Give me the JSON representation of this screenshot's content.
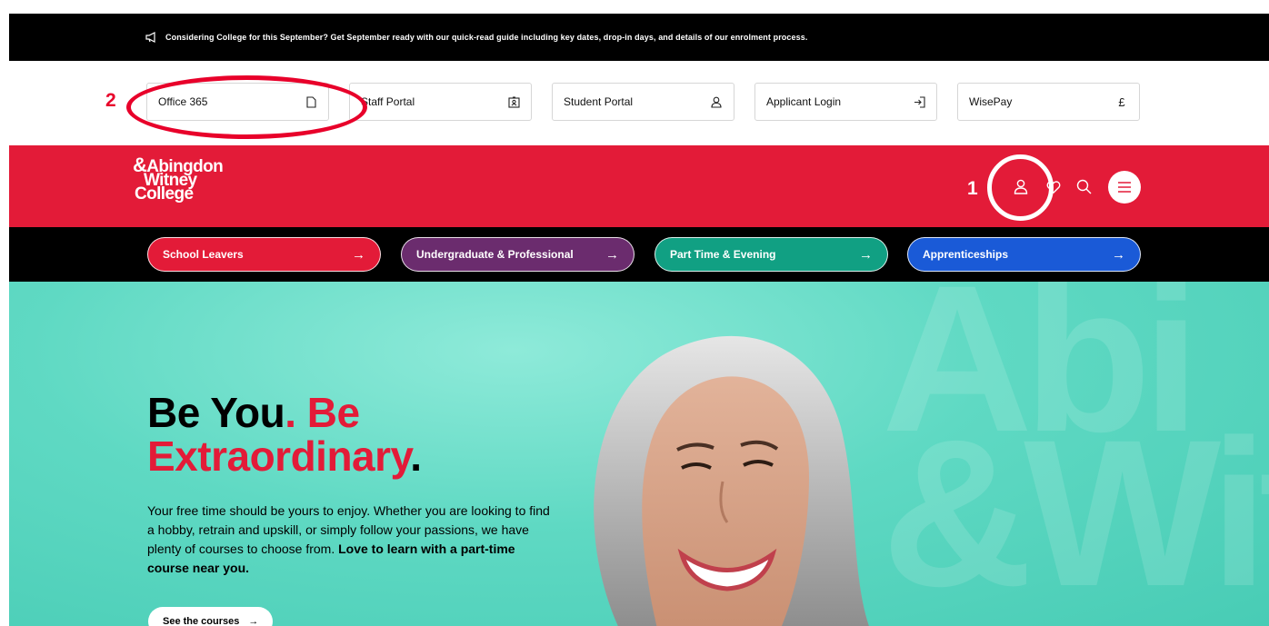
{
  "announcement": {
    "text": "Considering College for this September? Get September ready with our quick-read guide including key dates, drop-in days, and details of our enrolment process."
  },
  "quick_links": [
    {
      "label": "Office 365",
      "icon": "document-icon"
    },
    {
      "label": "Staff Portal",
      "icon": "id-badge-icon"
    },
    {
      "label": "Student Portal",
      "icon": "user-icon"
    },
    {
      "label": "Applicant Login",
      "icon": "login-icon"
    },
    {
      "label": "WisePay",
      "icon": "pound-icon",
      "glyph": "£"
    }
  ],
  "annotations": {
    "one": "1",
    "two": "2"
  },
  "header": {
    "logo_line1": "Abingdon",
    "logo_line2": "Witney",
    "logo_line3": "College",
    "logo_amp": "&"
  },
  "categories": [
    {
      "label": "School Leavers",
      "color": "#e31b38"
    },
    {
      "label": "Undergraduate & Professional",
      "color": "#6b2c6e"
    },
    {
      "label": "Part Time & Evening",
      "color": "#11a083"
    },
    {
      "label": "Apprenticeships",
      "color": "#1a5ad7"
    }
  ],
  "hero": {
    "headline_a": "Be You",
    "headline_dot1": ".",
    "headline_b": " Be",
    "headline_c": "Extraordinary",
    "headline_dot2": ".",
    "body": "Your free time should be yours to enjoy. Whether you are looking to find a hobby, retrain and upskill, or simply follow your passions, we have plenty of courses to choose from.",
    "body_bold": "Love to learn with a part-time course near you.",
    "cta": "See the courses",
    "cta_arrow": "→",
    "watermark_line1": "Abi",
    "watermark_line2": "&Wit"
  },
  "colors": {
    "brand_red": "#e31b38",
    "annotation_red": "#e8002a",
    "hero_teal": "#5fd9c3"
  }
}
